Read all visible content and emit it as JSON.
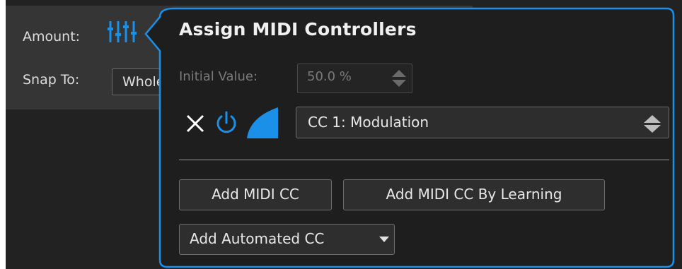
{
  "side": {
    "amount_label": "Amount:",
    "snap_label": "Snap To:",
    "snap_value": "Whole"
  },
  "popup": {
    "title": "Assign MIDI Controllers",
    "initial_value_label": "Initial Value:",
    "initial_value": "50.0 %",
    "controller": "CC 1: Modulation",
    "add_cc_label": "Add MIDI CC",
    "add_cc_learning_label": "Add MIDI CC By Learning",
    "add_automated_label": "Add Automated CC"
  },
  "colors": {
    "accent": "#1a90e8",
    "panel_bg": "#1e1e1e",
    "header_bg": "#353535"
  },
  "icons": [
    "sliders-icon",
    "close-icon",
    "power-icon",
    "curve-icon",
    "spinner-arrows-icon",
    "chevron-down-icon"
  ]
}
